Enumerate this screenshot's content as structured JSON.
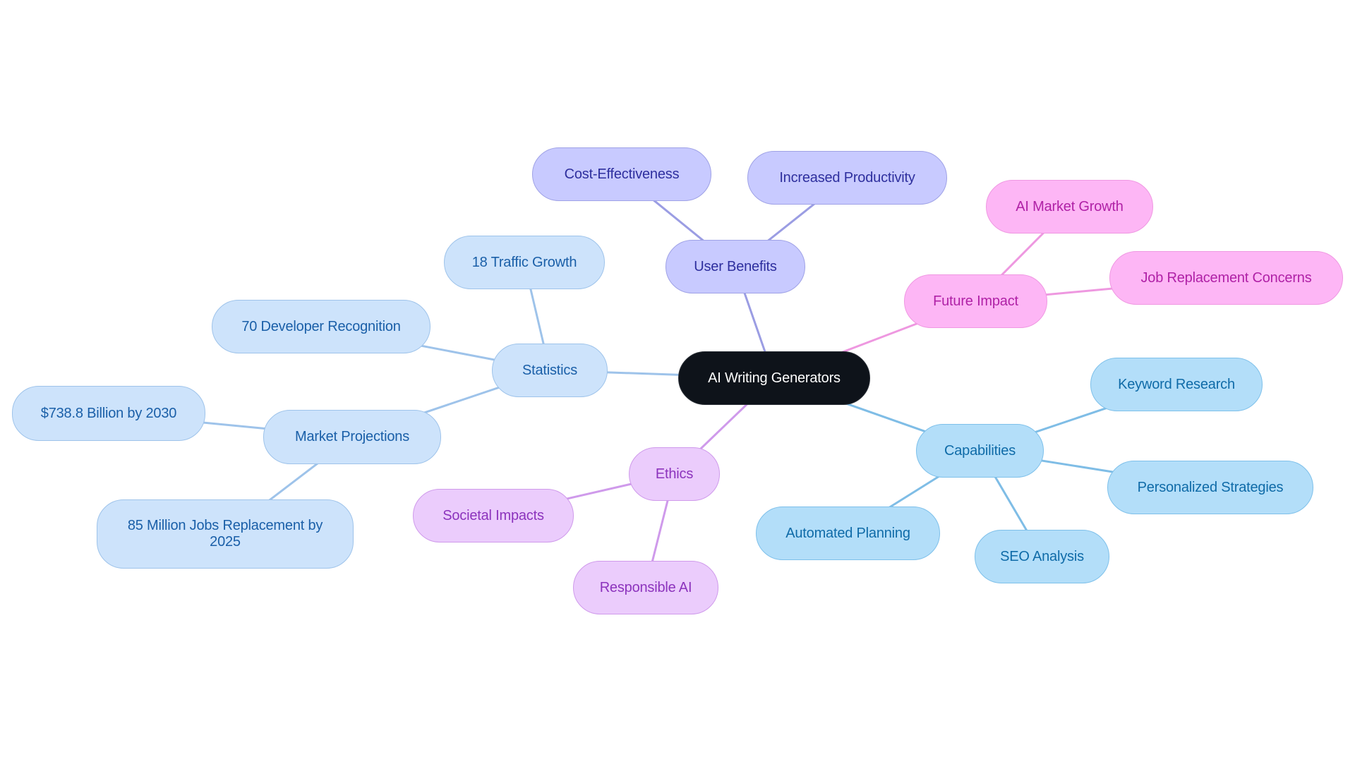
{
  "diagram": {
    "type": "mindmap",
    "root": {
      "id": "root",
      "label": "AI Writing Generators"
    },
    "branches": [
      {
        "id": "user-benefits",
        "label": "User Benefits",
        "color": {
          "fill": "#c8caff",
          "stroke": "#9fa2e6",
          "text": "#2e2f9e",
          "edge": "#9b9de3"
        },
        "children": [
          {
            "id": "cost-effectiveness",
            "label": "Cost-Effectiveness"
          },
          {
            "id": "increased-productivity",
            "label": "Increased Productivity"
          }
        ]
      },
      {
        "id": "future-impact",
        "label": "Future Impact",
        "color": {
          "fill": "#fdb6f5",
          "stroke": "#ef98e2",
          "text": "#b021a6",
          "edge": "#ee98e0"
        },
        "children": [
          {
            "id": "ai-market-growth",
            "label": "AI Market Growth"
          },
          {
            "id": "job-replacement-concerns",
            "label": "Job Replacement Concerns"
          }
        ]
      },
      {
        "id": "capabilities",
        "label": "Capabilities",
        "color": {
          "fill": "#b3def9",
          "stroke": "#7ec0ea",
          "text": "#0f6ba8",
          "edge": "#7fbde6"
        },
        "children": [
          {
            "id": "keyword-research",
            "label": "Keyword Research"
          },
          {
            "id": "personalized-strategies",
            "label": "Personalized Strategies"
          },
          {
            "id": "seo-analysis",
            "label": "SEO Analysis"
          },
          {
            "id": "automated-planning",
            "label": "Automated Planning"
          }
        ]
      },
      {
        "id": "ethics",
        "label": "Ethics",
        "color": {
          "fill": "#ebccfc",
          "stroke": "#cf9aeb",
          "text": "#8c33bd",
          "edge": "#cf9aeb"
        },
        "children": [
          {
            "id": "societal-impacts",
            "label": "Societal Impacts"
          },
          {
            "id": "responsible-ai",
            "label": "Responsible AI"
          }
        ]
      },
      {
        "id": "statistics",
        "label": "Statistics",
        "color": {
          "fill": "#cde3fb",
          "stroke": "#9ec3ea",
          "text": "#1a5fa8",
          "edge": "#9ec3ea"
        },
        "children": [
          {
            "id": "traffic-growth",
            "label": "18 Traffic Growth"
          },
          {
            "id": "developer-recognition",
            "label": "70 Developer Recognition"
          },
          {
            "id": "market-projections",
            "label": "Market Projections",
            "children": [
              {
                "id": "billion-2030",
                "label": "$738.8 Billion by 2030"
              },
              {
                "id": "million-jobs-2025",
                "label": "85 Million Jobs Replacement by 2025"
              }
            ]
          }
        ]
      }
    ],
    "root_color": {
      "fill": "#0e131a",
      "text": "#ffffff"
    }
  }
}
